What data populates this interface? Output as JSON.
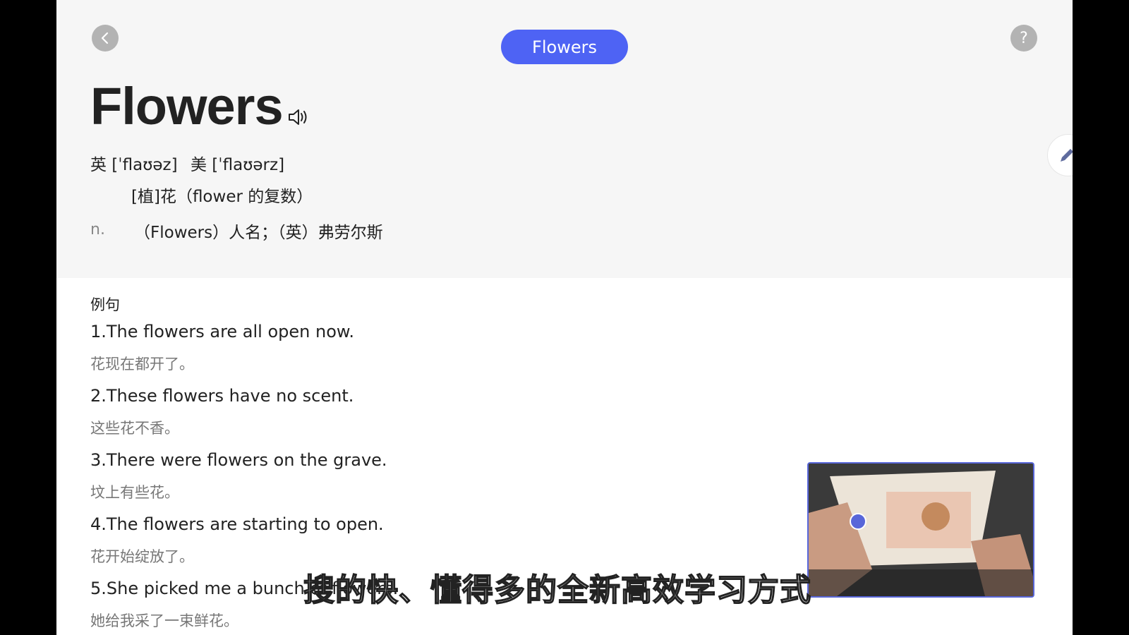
{
  "header": {
    "pill_label": "Flowers",
    "help_label": "?"
  },
  "entry": {
    "word": "Flowers",
    "phonetic_uk": "英 [ˈflaʊəz]",
    "phonetic_us": "美 [ˈflaʊərz]",
    "definition_1": "[植]花（flower 的复数）",
    "pos": "n.",
    "definition_2": "（Flowers）人名；（英）弗劳尔斯"
  },
  "examples": {
    "label": "例句",
    "items": [
      {
        "en": "1.The flowers are all open now.",
        "zh": "花现在都开了。"
      },
      {
        "en": "2.These flowers have no scent.",
        "zh": "这些花不香。"
      },
      {
        "en": "3.There were flowers on the grave.",
        "zh": "坟上有些花。"
      },
      {
        "en": "4.The flowers are starting to open.",
        "zh": "花开始绽放了。"
      },
      {
        "en": "5.She picked me a bunch of flowers.",
        "zh": "她给我采了一束鲜花。"
      }
    ]
  },
  "video_overlay": {
    "subtitle": "搜的快、懂得多的全新高效学习方式"
  },
  "icons": {
    "back": "chevron-left-icon",
    "help": "question-icon",
    "speaker": "speaker-icon",
    "edit": "pencil-icon"
  },
  "colors": {
    "accent": "#4e63f4",
    "header_bg": "#f6f6f6",
    "round_button": "#b3b3b3"
  }
}
